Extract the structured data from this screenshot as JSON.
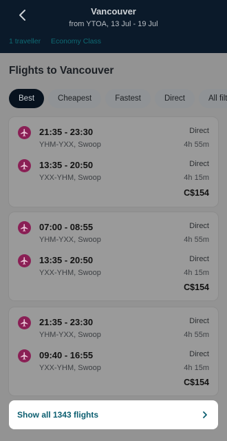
{
  "header": {
    "title": "Vancouver",
    "subtitle": "from YTOA, 13 Jul - 19 Jul",
    "travellers": "1 traveller",
    "cabin": "Economy Class"
  },
  "page_title": "Flights to Vancouver",
  "filters": [
    "Best",
    "Cheapest",
    "Fastest",
    "Direct",
    "All filters"
  ],
  "cards": [
    {
      "legs": [
        {
          "times": "21:35 - 23:30",
          "route": "YHM-YXX, Swoop",
          "stops": "Direct",
          "duration": "4h 55m"
        },
        {
          "times": "13:35 - 20:50",
          "route": "YXX-YHM, Swoop",
          "stops": "Direct",
          "duration": "4h 15m"
        }
      ],
      "price": "C$154"
    },
    {
      "legs": [
        {
          "times": "07:00 - 08:55",
          "route": "YHM-YXX, Swoop",
          "stops": "Direct",
          "duration": "4h 55m"
        },
        {
          "times": "13:35 - 20:50",
          "route": "YXX-YHM, Swoop",
          "stops": "Direct",
          "duration": "4h 15m"
        }
      ],
      "price": "C$154"
    },
    {
      "legs": [
        {
          "times": "21:35 - 23:30",
          "route": "YHM-YXX, Swoop",
          "stops": "Direct",
          "duration": "4h 55m"
        },
        {
          "times": "09:40 - 16:55",
          "route": "YXX-YHM, Swoop",
          "stops": "Direct",
          "duration": "4h 15m"
        }
      ],
      "price": "C$154"
    }
  ],
  "show_all": "Show all 1343 flights",
  "icons": {
    "back": "back-arrow-icon",
    "plane": "airplane-icon",
    "chevron": "chevron-right-icon"
  },
  "colors": {
    "header_bg": "#0b1a2a",
    "accent_teal": "#0c5e70",
    "airline_badge": "#8a1f55"
  }
}
